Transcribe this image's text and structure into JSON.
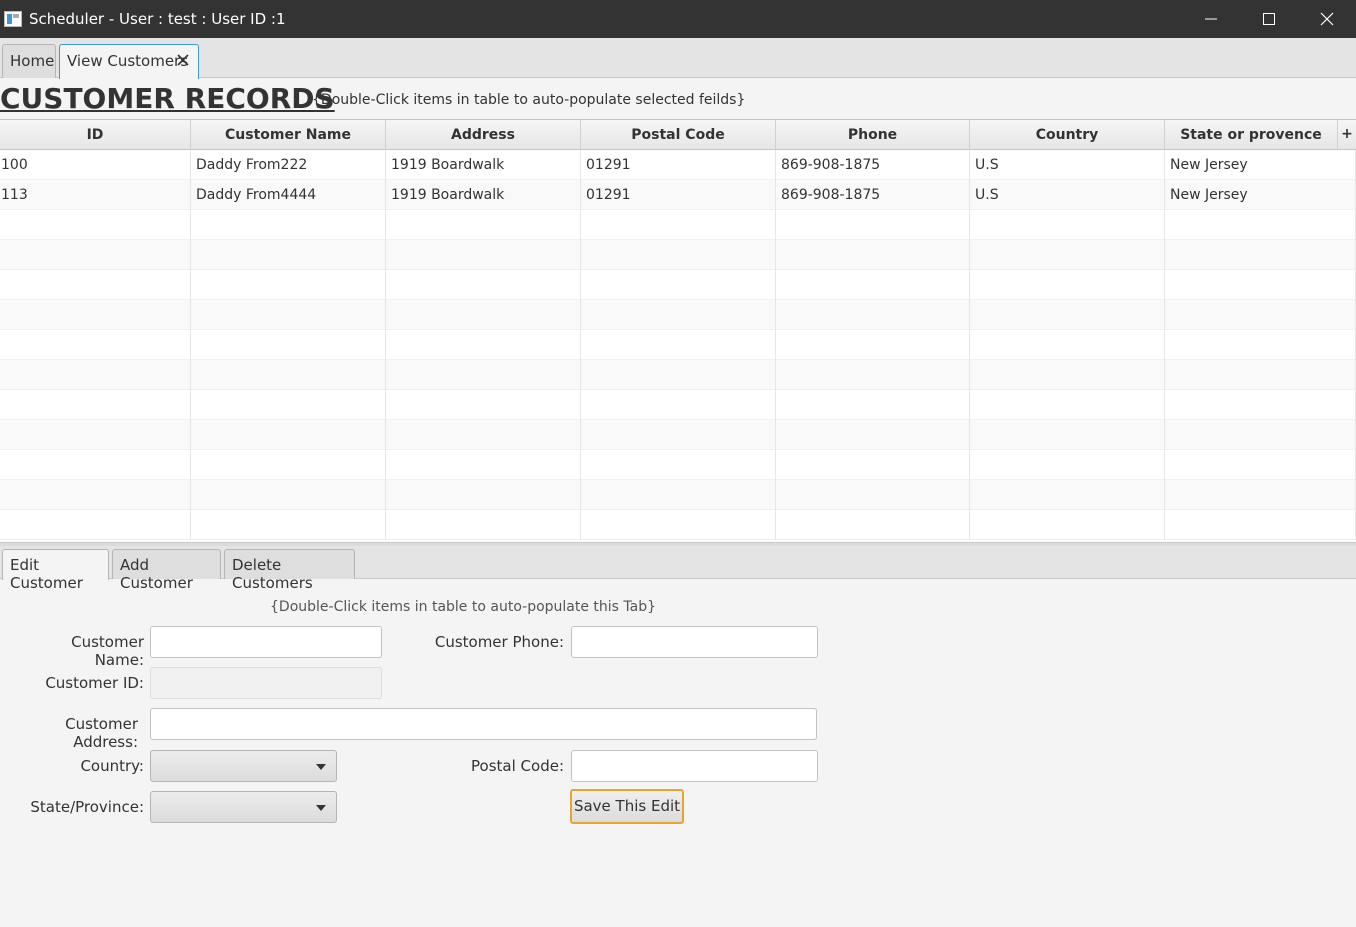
{
  "window": {
    "title": "Scheduler - User : test : User ID :1"
  },
  "top_tabs": [
    {
      "label": "Home",
      "active": false
    },
    {
      "label": "View Customers",
      "active": true
    }
  ],
  "heading": {
    "title": "CUSTOMER RECORDS",
    "hint": "{Double-Click items in table to auto-populate selected feilds}"
  },
  "table": {
    "columns": [
      "ID",
      "Customer Name",
      "Address",
      "Postal Code",
      "Phone",
      "Country",
      "State or provence"
    ],
    "plus": "+",
    "rows": [
      [
        "100",
        "Daddy From222",
        "1919 Boardwalk",
        "01291",
        "869-908-1875",
        "U.S",
        "New Jersey"
      ],
      [
        "113",
        "Daddy From4444",
        "1919 Boardwalk",
        "01291",
        "869-908-1875",
        "U.S",
        "New Jersey"
      ]
    ]
  },
  "bottom_tabs": [
    {
      "label": "Edit Customer",
      "active": true
    },
    {
      "label": "Add Customer",
      "active": false
    },
    {
      "label": "Delete Customers",
      "active": false
    }
  ],
  "form": {
    "hint": "{Double-Click items in table to auto-populate this Tab}",
    "customer_name_label": "Customer Name:",
    "customer_name_value": "",
    "customer_phone_label": "Customer Phone:",
    "customer_phone_value": "",
    "customer_id_label": "Customer ID:",
    "customer_id_value": "",
    "customer_address_label": "Customer Address:",
    "customer_address_value": "",
    "country_label": "Country:",
    "country_value": "",
    "postal_code_label": "Postal Code:",
    "postal_code_value": "",
    "state_label": "State/Province:",
    "state_value": "",
    "save_label": "Save This Edit"
  },
  "colors": {
    "titlebar": "#333333",
    "tab_focus": "#3a9ad9",
    "default_button_border": "#e6a532"
  },
  "icons": [
    "app-icon",
    "minimize-icon",
    "maximize-icon",
    "close-icon",
    "tab-close-icon",
    "chevron-down-icon"
  ]
}
